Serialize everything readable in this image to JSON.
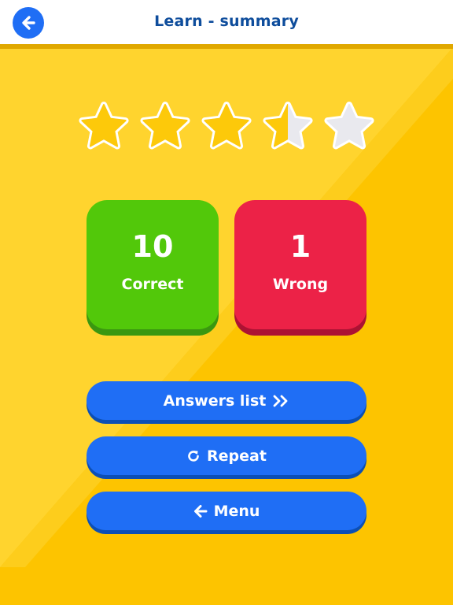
{
  "header": {
    "title": "Learn - summary",
    "back_icon": "arrow-left-icon"
  },
  "rating": {
    "value": 3.5,
    "max": 5,
    "filled_color": "#fdc90a",
    "empty_color": "#e9e9ee"
  },
  "results": {
    "correct": {
      "count": "10",
      "label": "Correct",
      "color": "#52c80a"
    },
    "wrong": {
      "count": "1",
      "label": "Wrong",
      "color": "#ec2247"
    }
  },
  "buttons": {
    "answers_list": {
      "label": "Answers list",
      "icon": "double-chevron-right-icon"
    },
    "repeat": {
      "label": "Repeat",
      "icon": "refresh-icon"
    },
    "menu": {
      "label": "Menu",
      "icon": "arrow-left-icon"
    }
  },
  "colors": {
    "background": "#fdc400",
    "background_light": "#ffd42e",
    "accent_blue": "#1f6ef5",
    "title_blue": "#0e4d9c"
  }
}
